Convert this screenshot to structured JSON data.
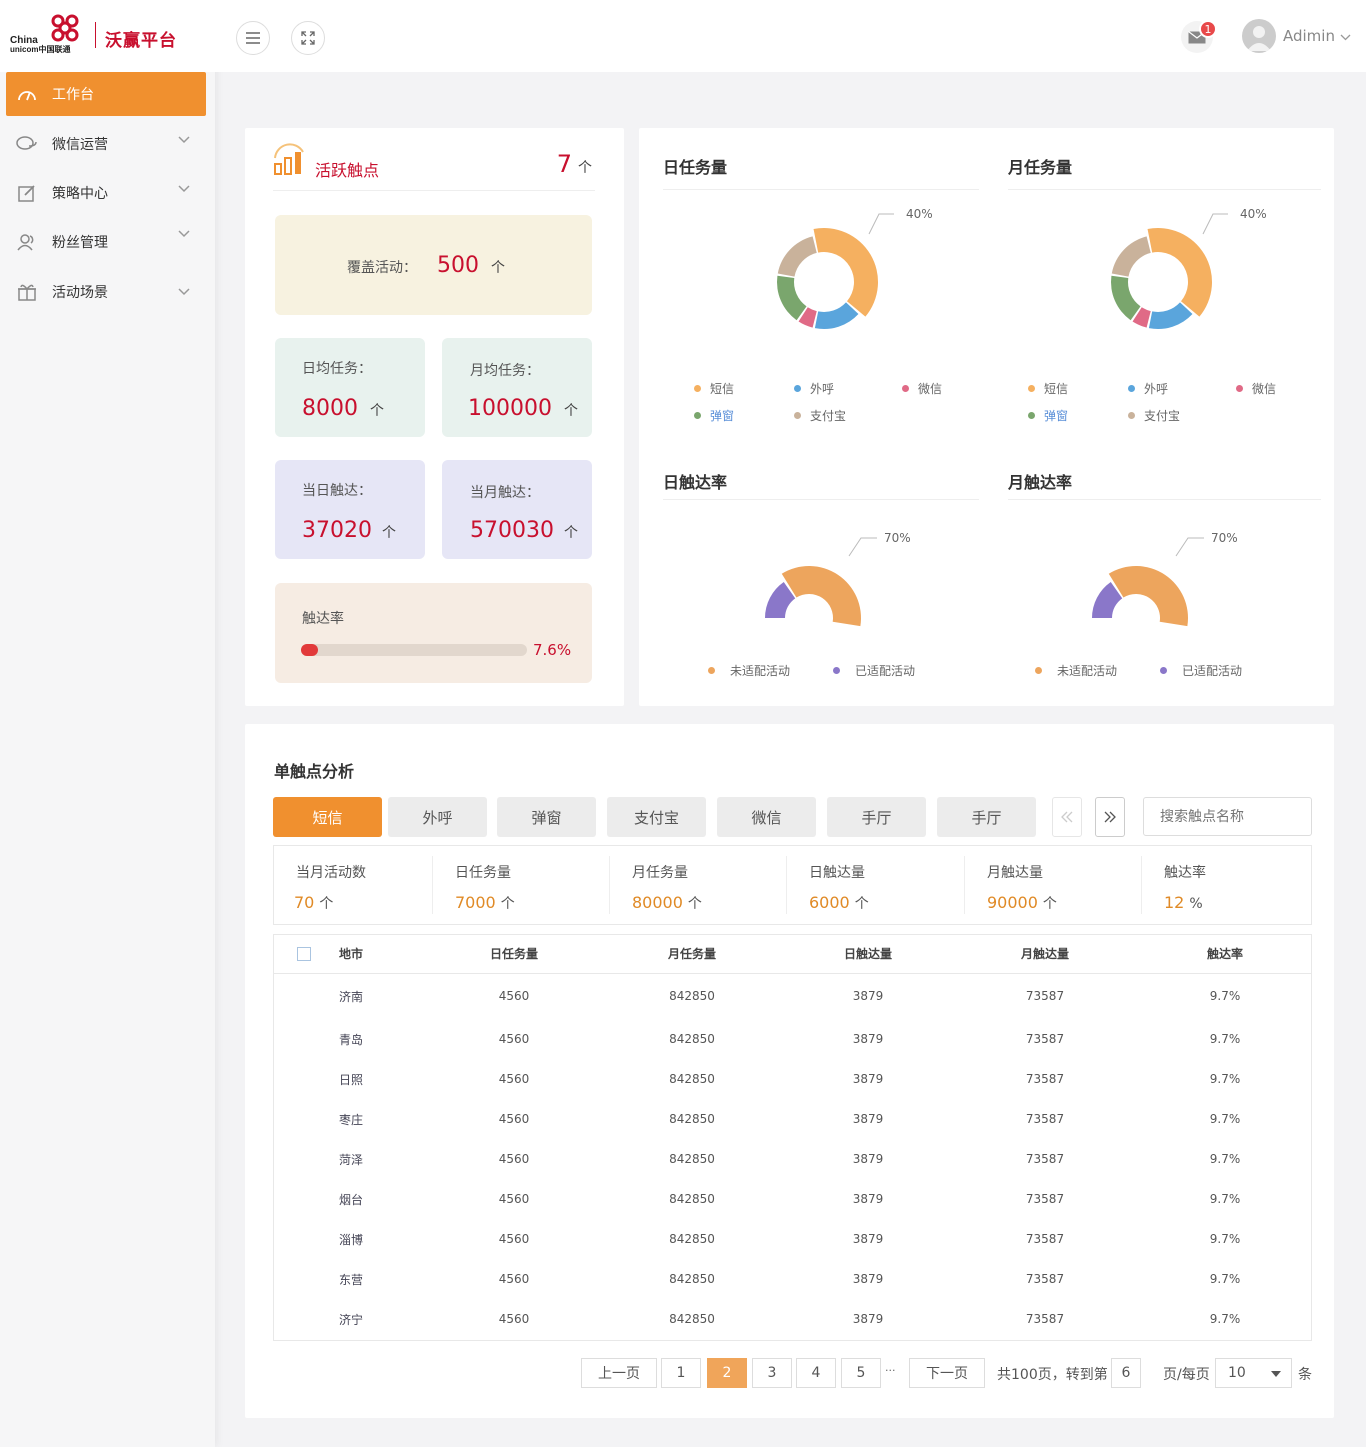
{
  "logo": {
    "cn_line1": "China",
    "cn_line2": "unicom中国联通",
    "brand": "沃赢平台"
  },
  "sidebar": {
    "items": [
      {
        "label": "工作台",
        "icon": "dashboard-icon"
      },
      {
        "label": "微信运营",
        "icon": "chat-icon"
      },
      {
        "label": "策略中心",
        "icon": "edit-icon"
      },
      {
        "label": "粉丝管理",
        "icon": "users-icon"
      },
      {
        "label": "活动场景",
        "icon": "gift-icon"
      }
    ]
  },
  "header": {
    "mail_badge": "1",
    "user_name": "Adimin"
  },
  "touch": {
    "title": "活跃触点",
    "count": "7",
    "count_unit": "个",
    "cover_label": "覆盖活动：",
    "cover_value": "500",
    "cover_unit": "个",
    "daily_task_label": "日均任务：",
    "daily_task_value": "8000",
    "daily_task_unit": "个",
    "monthly_task_label": "月均任务：",
    "monthly_task_value": "100000",
    "monthly_task_unit": "个",
    "day_reach_label": "当日触达：",
    "day_reach_value": "37020",
    "day_reach_unit": "个",
    "month_reach_label": "当月触达：",
    "month_reach_value": "570030",
    "month_reach_unit": "个",
    "rate_label": "触达率",
    "rate_value": "7.6%",
    "rate_fraction": 0.076
  },
  "colors": {
    "accent": "#f0902f",
    "brand_red": "#c8102e",
    "sms": "#f5b060",
    "call": "#5aa5dc",
    "wechat": "#e06a86",
    "popup": "#7aa66d",
    "alipay": "#c9b29b",
    "unmatched": "#eda55d",
    "matched": "#8a77c9"
  },
  "charts": {
    "daily_task_title": "日任务量",
    "monthly_task_title": "月任务量",
    "daily_rate_title": "日触达率",
    "monthly_rate_title": "月触达率"
  },
  "chart_data": [
    {
      "type": "pie",
      "title": "日任务量",
      "categories": [
        "短信",
        "外呼",
        "微信",
        "弹窗",
        "支付宝"
      ],
      "values": [
        40,
        17,
        6,
        18,
        19
      ],
      "annotation": "40%"
    },
    {
      "type": "pie",
      "title": "月任务量",
      "categories": [
        "短信",
        "外呼",
        "微信",
        "弹窗",
        "支付宝"
      ],
      "values": [
        40,
        17,
        6,
        18,
        19
      ],
      "annotation": "40%"
    },
    {
      "type": "pie",
      "title": "日触达率",
      "categories": [
        "未适配活动",
        "已适配活动"
      ],
      "values": [
        70,
        30
      ],
      "annotation": "70%"
    },
    {
      "type": "pie",
      "title": "月触达率",
      "categories": [
        "未适配活动",
        "已适配活动"
      ],
      "values": [
        70,
        30
      ],
      "annotation": "70%"
    }
  ],
  "analysis": {
    "title": "单触点分析",
    "tabs": [
      "短信",
      "外呼",
      "弹窗",
      "支付宝",
      "微信",
      "手厅",
      "手厅"
    ],
    "search_placeholder": "搜索触点名称",
    "metrics": [
      {
        "label": "当月活动数",
        "value": "70",
        "unit": "个"
      },
      {
        "label": "日任务量",
        "value": "7000",
        "unit": "个"
      },
      {
        "label": "月任务量",
        "value": "80000",
        "unit": "个"
      },
      {
        "label": "日触达量",
        "value": "6000",
        "unit": "个"
      },
      {
        "label": "月触达量",
        "value": "90000",
        "unit": "个"
      },
      {
        "label": "触达率",
        "value": "12",
        "unit": "%"
      }
    ],
    "columns": [
      "地市",
      "日任务量",
      "月任务量",
      "日触达量",
      "月触达量",
      "触达率"
    ],
    "rows": [
      [
        "济南",
        "4560",
        "842850",
        "3879",
        "73587",
        "9.7%"
      ],
      [
        "青岛",
        "4560",
        "842850",
        "3879",
        "73587",
        "9.7%"
      ],
      [
        "日照",
        "4560",
        "842850",
        "3879",
        "73587",
        "9.7%"
      ],
      [
        "枣庄",
        "4560",
        "842850",
        "3879",
        "73587",
        "9.7%"
      ],
      [
        "菏泽",
        "4560",
        "842850",
        "3879",
        "73587",
        "9.7%"
      ],
      [
        "烟台",
        "4560",
        "842850",
        "3879",
        "73587",
        "9.7%"
      ],
      [
        "淄博",
        "4560",
        "842850",
        "3879",
        "73587",
        "9.7%"
      ],
      [
        "东营",
        "4560",
        "842850",
        "3879",
        "73587",
        "9.7%"
      ],
      [
        "济宁",
        "4560",
        "842850",
        "3879",
        "73587",
        "9.7%"
      ]
    ]
  },
  "pagination": {
    "prev": "上一页",
    "pages": [
      "1",
      "2",
      "3",
      "4",
      "5"
    ],
    "current": "2",
    "ellipsis": "···",
    "next": "下一页",
    "total_text": "共100页，转到第",
    "goto_value": "6",
    "per_page_label": "页/每页",
    "per_page_value": "10",
    "per_page_unit": "条"
  }
}
